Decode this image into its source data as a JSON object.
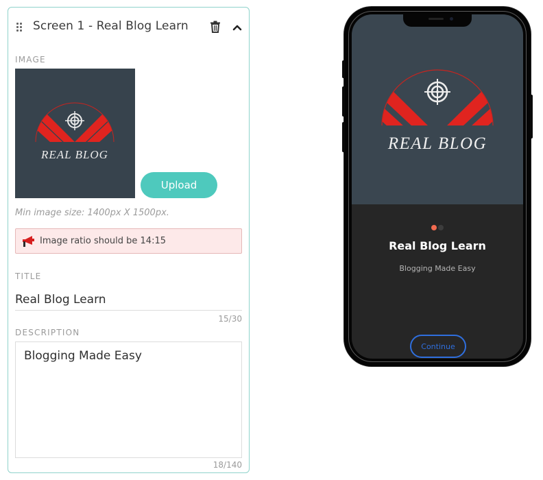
{
  "editor": {
    "screen_title": "Screen 1 - Real Blog Learn",
    "image_section": {
      "label": "IMAGE",
      "preview_logo_text": "REAL BLOG",
      "upload_label": "Upload",
      "hint": "Min image size: 1400px X 1500px.",
      "alert": {
        "icon": "megaphone-icon",
        "text": "Image ratio should be 14:15"
      }
    },
    "title_field": {
      "label": "TITLE",
      "value": "Real Blog Learn",
      "counter": "15/30"
    },
    "description_field": {
      "label": "DESCRIPTION",
      "value": "Blogging Made Easy",
      "counter": "18/140"
    },
    "icons": {
      "drag": "drag-handle-icon",
      "delete": "trash-icon",
      "collapse": "chevron-up-icon"
    }
  },
  "preview": {
    "logo_text": "REAL BLOG",
    "pager": {
      "total": 2,
      "active": 1
    },
    "title": "Real Blog Learn",
    "subtitle": "Blogging Made Easy",
    "continue_label": "Continue"
  },
  "colors": {
    "accent": "#4ec9bd",
    "card_border": "#8fd3cb",
    "alert_bg": "#fde9e9",
    "alert_border": "#e6b7b7",
    "logo_red": "#e0241f",
    "image_bg": "#37434d",
    "phone_screen_bottom": "#262626",
    "dot_active": "#f26b50",
    "dot_inactive": "#3d3d3d",
    "continue_blue": "#2f6fde"
  }
}
